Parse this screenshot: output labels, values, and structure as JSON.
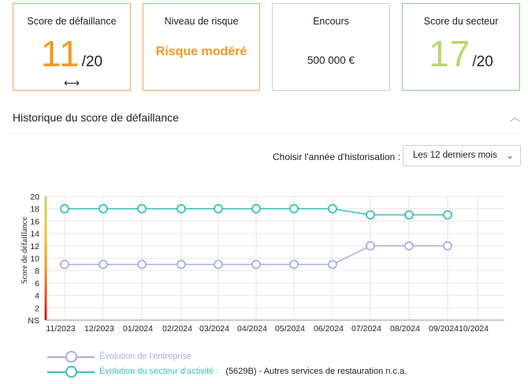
{
  "cards": {
    "default_score": {
      "title": "Score de défaillance",
      "value": "11",
      "denominator": "/20",
      "trend_icon": "left-right-arrow-icon",
      "color": "#f39a1f"
    },
    "risk_level": {
      "title": "Niveau de risque",
      "value": "Risque modéré",
      "color": "#f39a1f"
    },
    "outstanding": {
      "title": "Encours",
      "value": "500 000 €"
    },
    "sector_score": {
      "title": "Score du secteur",
      "value": "17",
      "denominator": "/20",
      "color": "#b5d96a"
    }
  },
  "history": {
    "title": "Historique du score de défaillance",
    "collapse_icon": "chevron-up-icon",
    "year_label": "Choisir l'année d'historisation :",
    "year_select": {
      "value": "Les 12 derniers mois",
      "icon": "chevron-down-icon"
    }
  },
  "chart_data": {
    "type": "line",
    "ylabel": "Score de défaillance",
    "yticks": [
      "NS",
      "2",
      "4",
      "6",
      "8",
      "10",
      "12",
      "14",
      "16",
      "18",
      "20"
    ],
    "ylim": [
      0,
      20
    ],
    "categories": [
      "11/2023",
      "12/2023",
      "01/2024",
      "02/2024",
      "03/2024",
      "04/2024",
      "05/2024",
      "06/2024",
      "07/2024",
      "08/2024",
      "09/2024",
      "10/2024"
    ],
    "grid": true,
    "series": [
      {
        "name": "Évolution de l'entreprise",
        "color": "#a8aedd",
        "values": [
          9,
          9,
          9,
          9,
          9,
          9,
          9,
          9,
          12,
          12,
          12,
          null
        ]
      },
      {
        "name": "Évolution du secteur d'activité :",
        "color": "#3cbfb3",
        "values": [
          18,
          18,
          18,
          18,
          18,
          18,
          18,
          18,
          17,
          17,
          17,
          null
        ]
      }
    ],
    "legend": {
      "placement": "bottom-left",
      "company_label": "Évolution de l'entreprise",
      "sector_label": "Évolution du secteur d'activité :",
      "sector_detail": "(5629B) - Autres services de restauration n.c.a."
    }
  }
}
